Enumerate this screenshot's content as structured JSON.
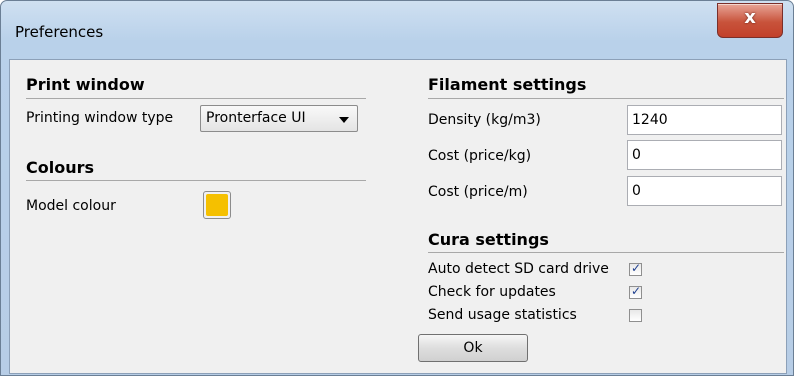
{
  "window": {
    "title": "Preferences",
    "close_glyph": "x"
  },
  "print_window": {
    "heading": "Print window",
    "type_label": "Printing window type",
    "type_value": "Pronterface UI"
  },
  "colours": {
    "heading": "Colours",
    "model_label": "Model colour",
    "model_color": "#f5c000"
  },
  "filament": {
    "heading": "Filament settings",
    "density_label": "Density (kg/m3)",
    "density_value": "1240",
    "cost_kg_label": "Cost (price/kg)",
    "cost_kg_value": "0",
    "cost_m_label": "Cost (price/m)",
    "cost_m_value": "0"
  },
  "cura": {
    "heading": "Cura settings",
    "auto_detect_label": "Auto detect SD card drive",
    "auto_detect_checked": true,
    "updates_label": "Check for updates",
    "updates_checked": true,
    "usage_label": "Send usage statistics",
    "usage_checked": false
  },
  "ok_label": "Ok"
}
